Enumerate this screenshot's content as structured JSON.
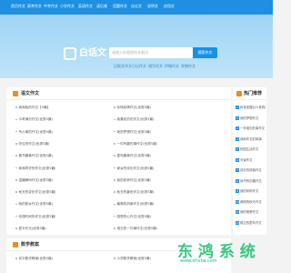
{
  "nav": [
    "首页作文",
    "高考作文",
    "中考作文",
    "小学作文",
    "英语作文",
    "读后感",
    "话题作文",
    "议论文",
    "说明文",
    "应用文"
  ],
  "logo": "白话文",
  "search": {
    "placeholder": "请输入你要搜的关键词",
    "button": "搜索作文"
  },
  "tags": [
    "记叙文作文",
    "日记作文",
    "描写作文",
    "抒情作文",
    "状物作文"
  ],
  "section1": {
    "title": "语文作文",
    "left": [
      "我和我的作文【5篇】",
      "中考满分作文(优秀5篇)",
      "写小事的作文(优秀5篇)",
      "听见的作文(优秀5篇)",
      "春节趣事作文(优秀5篇)",
      "我和同学的作文(优秀5篇)",
      "温暖瞬间作文(优秀5篇)",
      "秋天的变化作文(优秀5篇)",
      "我的家乡作文(优秀5篇)",
      "珍惜时间的作文(优秀5篇)",
      "夏天作文(优秀5篇)"
    ],
    "right": [
      "珍惜亲情作文(优秀5篇)",
      "我喜欢的花作文(优秀5篇)",
      "我的梦想作文(优秀5篇)",
      "一件有趣的事作文(优秀5篇)",
      "童年趣事作文(优秀5篇)",
      "家乡的变化作文(优秀5篇)",
      "我的老师作文(优秀5篇)",
      "秋天的景色作文(优秀5篇)",
      "最美的风景作文(优秀5篇)",
      "感恩的心作文(优秀5篇)",
      "难忘的一件事作文(优秀5篇)"
    ]
  },
  "hot": {
    "title": "热门推荐",
    "items": [
      "科技发展对人类的影响作文",
      "我的梦想作文",
      "一件难忘的事作文",
      "我和作文的故事",
      "校园生活作文",
      "写景作文",
      "成长的烦恼作文",
      "读书的乐趣作文",
      "我的妈妈作文",
      "美丽的秋天作文",
      "我的爸爸作文",
      "难忘的童年作文"
    ]
  },
  "section2": {
    "title": "数学教案",
    "left": [
      "初中数学教案(优秀5篇)"
    ],
    "right": [
      "小学数学教案(优秀5篇)"
    ]
  },
  "watermark": {
    "main": "东 鸿 系 统",
    "sub": "www.dhxtw.com"
  }
}
